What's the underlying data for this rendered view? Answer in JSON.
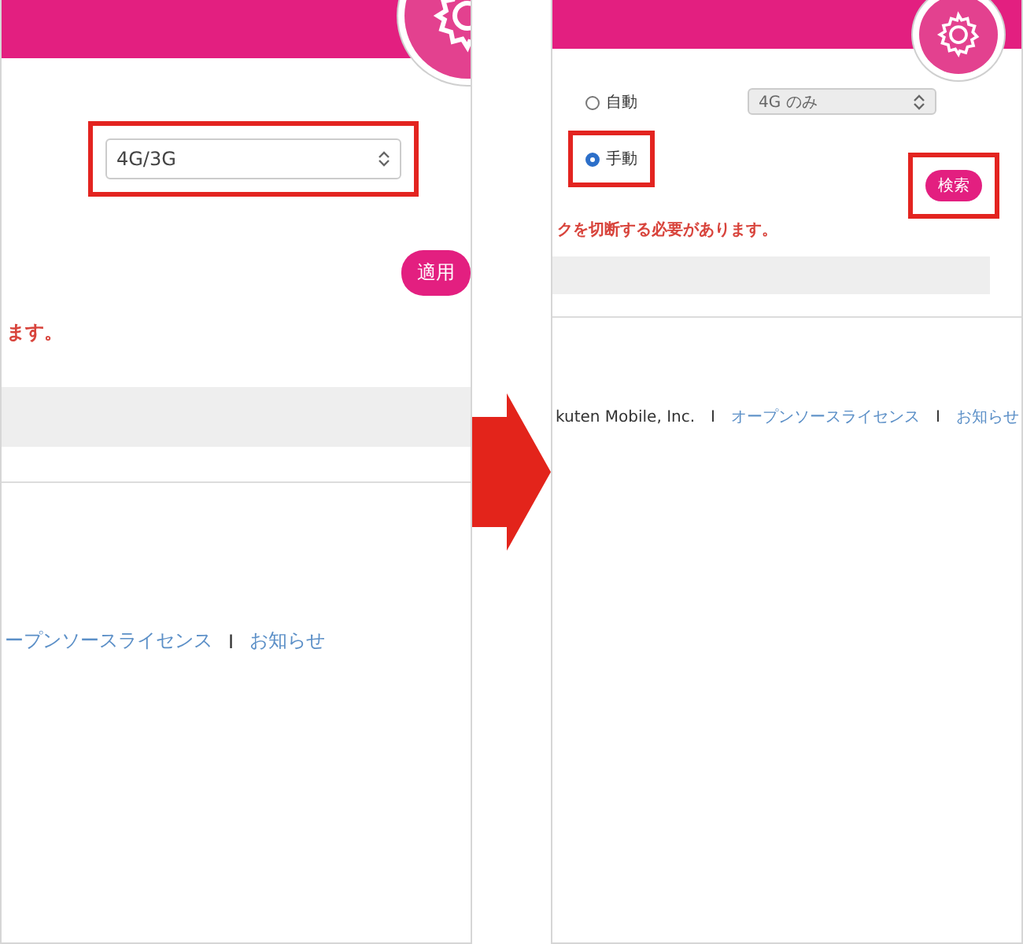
{
  "panels": [
    {
      "kind": "large",
      "select": {
        "value": "4G/3G",
        "disabled": false,
        "highlighted": true
      },
      "button": {
        "label": "適用",
        "highlighted": false
      },
      "warning": "ます。",
      "footer": [
        {
          "text": "ープンソースライセンス",
          "link": true
        },
        {
          "text": "I",
          "link": false
        },
        {
          "text": "お知らせ",
          "link": true
        }
      ]
    },
    {
      "kind": "small",
      "radios": [
        {
          "label": "自動",
          "selected": false,
          "highlighted": false
        },
        {
          "label": "手動",
          "selected": true,
          "highlighted": true
        }
      ],
      "select": {
        "value": "4G のみ",
        "disabled": true,
        "highlighted": false
      },
      "button": {
        "label": "検索",
        "highlighted": true
      },
      "warning": "クを切断する必要があります。",
      "footer": [
        {
          "text": "kuten Mobile, Inc.",
          "link": false
        },
        {
          "text": "I",
          "link": false
        },
        {
          "text": "オープンソースライセンス",
          "link": true
        },
        {
          "text": "I",
          "link": false
        },
        {
          "text": "お知らせ",
          "link": true
        }
      ]
    }
  ]
}
